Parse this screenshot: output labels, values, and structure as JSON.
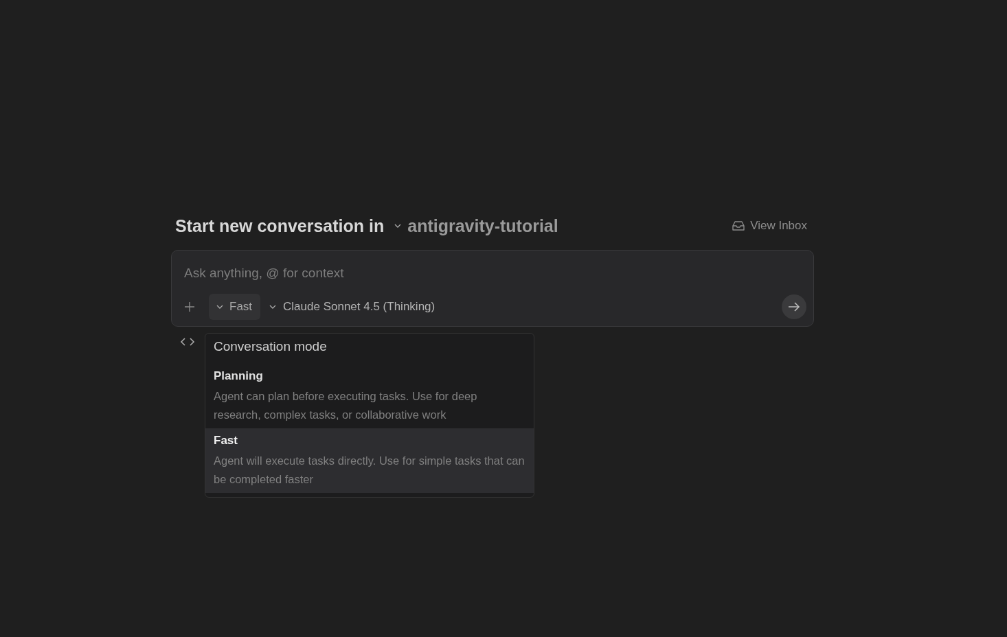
{
  "header": {
    "title": "Start new conversation in",
    "workspace": "antigravity-tutorial",
    "inbox_link": "View Inbox"
  },
  "composer": {
    "placeholder": "Ask anything, @ for context",
    "mode": "Fast",
    "model": "Claude Sonnet 4.5 (Thinking)"
  },
  "mode_menu": {
    "title": "Conversation mode",
    "options": [
      {
        "name": "Planning",
        "description": "Agent can plan before executing tasks. Use for deep research, complex tasks, or collaborative work",
        "selected": false
      },
      {
        "name": "Fast",
        "description": "Agent will execute tasks directly. Use for simple tasks that can be completed faster",
        "selected": true
      }
    ]
  }
}
